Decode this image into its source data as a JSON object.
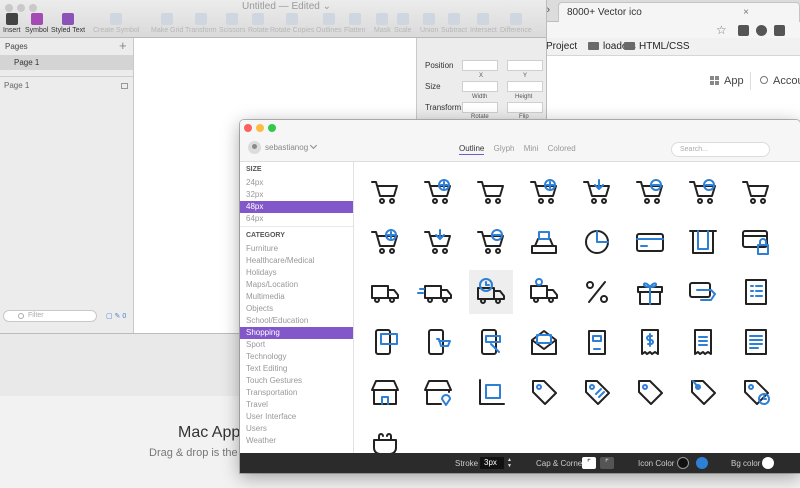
{
  "browser": {
    "tab_title": "8000+ Vector ico",
    "tab_close": "×",
    "tabs_chevron": "»",
    "star": "☆",
    "bookmarks": [
      {
        "label": "Project",
        "folder": false
      },
      {
        "label": "loaders",
        "folder": true
      },
      {
        "label": "HTML/CSS",
        "folder": true
      }
    ],
    "nav": {
      "app": "App",
      "account": "Accoun"
    }
  },
  "background": {
    "title": "Mac App",
    "subtitle": "Drag & drop is the ne"
  },
  "sketch": {
    "doc_title": "Untitled — Edited ⌄",
    "toolbar": [
      {
        "label": "Insert",
        "state": "active",
        "icon": "insert-icon"
      },
      {
        "label": "Symbol",
        "state": "active",
        "icon": "symbol-icon"
      },
      {
        "label": "Styled Text",
        "state": "active",
        "icon": "styled-text-icon"
      },
      {
        "label": "Create Symbol",
        "state": "disabled",
        "icon": "create-symbol-icon"
      },
      {
        "label": "Make Grid",
        "state": "disabled",
        "icon": "grid-icon"
      },
      {
        "label": "Transform",
        "state": "disabled",
        "icon": "transform-icon"
      },
      {
        "label": "Scissors",
        "state": "disabled",
        "icon": "scissors-icon"
      },
      {
        "label": "Rotate",
        "state": "disabled",
        "icon": "rotate-icon"
      },
      {
        "label": "Rotate Copies",
        "state": "disabled",
        "icon": "rotate-copies-icon"
      },
      {
        "label": "Outlines",
        "state": "disabled",
        "icon": "outlines-icon"
      },
      {
        "label": "Flatten",
        "state": "disabled",
        "icon": "flatten-icon"
      },
      {
        "label": "Mask",
        "state": "disabled",
        "icon": "mask-icon"
      },
      {
        "label": "Scale",
        "state": "disabled",
        "icon": "scale-icon"
      },
      {
        "label": "Union",
        "state": "disabled",
        "icon": "union-icon"
      },
      {
        "label": "Subtract",
        "state": "disabled",
        "icon": "subtract-icon"
      },
      {
        "label": "Intersect",
        "state": "disabled",
        "icon": "intersect-icon"
      },
      {
        "label": "Difference",
        "state": "disabled",
        "icon": "difference-icon"
      }
    ],
    "pages_header": "Pages",
    "add_page": "+",
    "selected_page": "Page 1",
    "layer": "Page 1",
    "filter_placeholder": "Filter",
    "bottom_count": "0",
    "inspector": {
      "position": "Position",
      "x": "X",
      "y": "Y",
      "size": "Size",
      "width": "Width",
      "height": "Height",
      "transform": "Transform",
      "rotate": "Rotate",
      "flip": "Flip"
    }
  },
  "app": {
    "username": "sebastianog",
    "tabs": [
      "Outline",
      "Glyph",
      "Mini",
      "Colored"
    ],
    "active_tab": "Outline",
    "search_placeholder": "Search...",
    "size_header": "SIZE",
    "sizes": [
      "24px",
      "32px",
      "48px",
      "64px"
    ],
    "selected_size": "48px",
    "category_header": "CATEGORY",
    "categories": [
      "Furniture",
      "Healthcare/Medical",
      "Holidays",
      "Maps/Location",
      "Multimedia",
      "Objects",
      "School/Education",
      "Shopping",
      "Sport",
      "Technology",
      "Text Editing",
      "Touch Gestures",
      "Transportation",
      "Travel",
      "User Interface",
      "Users",
      "Weather"
    ],
    "selected_category": "Shopping",
    "icons": [
      "cart-icon",
      "cart-add-icon",
      "cart-icon",
      "cart-add-icon",
      "cart-download-icon",
      "cart-remove-icon",
      "cart-remove-icon",
      "cart-icon",
      "cart-add-icon",
      "cart-download-icon",
      "cart-remove-icon",
      "cash-register-icon",
      "pie-chart-icon",
      "credit-card-icon",
      "atm-card-icon",
      "card-lock-icon",
      "delivery-truck-icon",
      "fast-delivery-icon",
      "delivery-time-icon",
      "delivery-user-icon",
      "percent-icon",
      "gift-icon",
      "card-payment-icon",
      "receipt-list-icon",
      "mobile-card-icon",
      "mobile-cart-icon",
      "mobile-pay-icon",
      "envelope-icon",
      "shopping-bag-icon",
      "bill-dollar-icon",
      "receipt-icon",
      "receipt-lines-icon",
      "store-icon",
      "store-location-icon",
      "box-stand-icon",
      "tag-icon",
      "tag-lines-icon",
      "tag-icon",
      "tag-pin-icon",
      "tag-time-icon",
      "purse-icon"
    ],
    "selected_icon_index": 18,
    "footer": {
      "stroke_label": "Stroke",
      "stroke_value": "3px",
      "cap_label": "Cap & Corner",
      "icon_color_label": "Icon Color",
      "bg_color_label": "Bg color"
    },
    "colors": {
      "accent": "#8157c9",
      "primary_ink": "#222222",
      "secondary_ink": "#2e7fd6",
      "footer_bg": "#2b2b2b",
      "icon_color_1": "#111111",
      "icon_color_2": "#2e7fd6",
      "bg_color": "#ffffff"
    }
  }
}
